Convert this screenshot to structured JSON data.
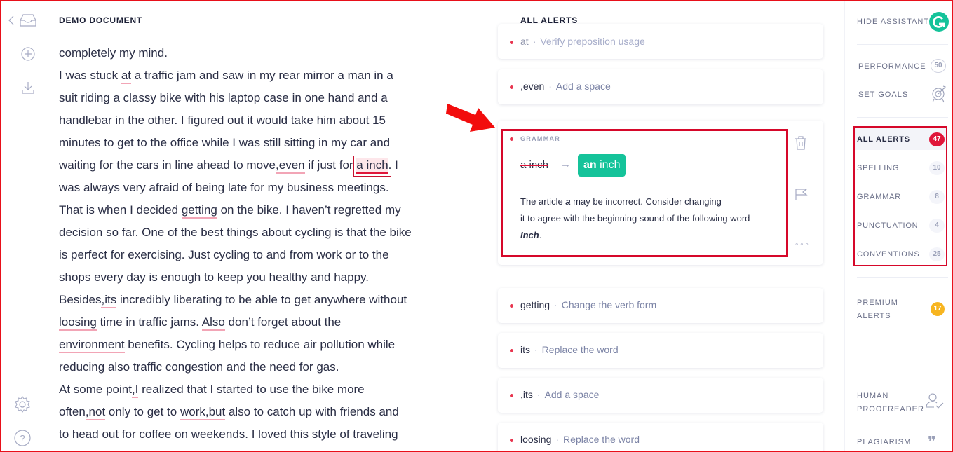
{
  "document": {
    "title": "DEMO DOCUMENT",
    "lines": [
      [
        {
          "t": "completely my mind."
        }
      ],
      [
        {
          "t": "I was stuck "
        },
        {
          "t": "at",
          "u": true
        },
        {
          "t": " a traffic jam and saw in my rear mirror a man in a"
        }
      ],
      [
        {
          "t": "suit riding a classy bike with his laptop case in one hand and a"
        }
      ],
      [
        {
          "t": "handlebar in the other. I figured out it would take him about 15"
        }
      ],
      [
        {
          "t": "minutes to get to the office while I was still sitting in my car and"
        }
      ],
      [
        {
          "t": "waiting for the cars in line ahead to move"
        },
        {
          "t": ",even",
          "u": true
        },
        {
          "t": " if just for "
        },
        {
          "t": "a inch",
          "active": true
        },
        {
          "t": ". I"
        }
      ],
      [
        {
          "t": "was always very afraid of being late for my business meetings."
        }
      ],
      [
        {
          "t": "That is when I decided "
        },
        {
          "t": "getting",
          "u": true
        },
        {
          "t": " on the bike. I haven’t regretted my"
        }
      ],
      [
        {
          "t": "decision so far. One of the best things about cycling is that the bike"
        }
      ],
      [
        {
          "t": "is perfect for exercising. Just cycling to and from work or to the"
        }
      ],
      [
        {
          "t": "shops every day is enough to keep you healthy and happy."
        }
      ],
      [
        {
          "t": "Besides"
        },
        {
          "t": ",its",
          "u": true
        },
        {
          "t": " incredibly liberating to be able to get anywhere without"
        }
      ],
      [
        {
          "t": "loosing",
          "u": true
        },
        {
          "t": " time in traffic jams. "
        },
        {
          "t": "Also",
          "u": true
        },
        {
          "t": " don’t forget about the"
        }
      ],
      [
        {
          "t": "environment",
          "u": true
        },
        {
          "t": " benefits. Cycling helps to reduce air pollution while"
        }
      ],
      [
        {
          "t": "reducing also traffic congestion and the need for gas."
        }
      ],
      [
        {
          "t": "At some point"
        },
        {
          "t": ",I",
          "u": true
        },
        {
          "t": " realized that I started to use the bike more"
        }
      ],
      [
        {
          "t": "often"
        },
        {
          "t": ",not",
          "u": true
        },
        {
          "t": " only to get to "
        },
        {
          "t": "work,but",
          "u": true
        },
        {
          "t": " also to catch up with friends and"
        }
      ],
      [
        {
          "t": "to head out for coffee on weekends. I loved this style of traveling"
        }
      ]
    ]
  },
  "alerts": {
    "title": "ALL ALERTS",
    "items": [
      {
        "word": "at",
        "sep": "·",
        "desc": "Verify preposition usage"
      },
      {
        "word": ",even",
        "sep": "·",
        "desc": "Add a space"
      },
      {
        "word": "getting",
        "sep": "·",
        "desc": "Change the verb form"
      },
      {
        "word": "its",
        "sep": "·",
        "desc": "Replace the word"
      },
      {
        "word": ",its",
        "sep": "·",
        "desc": "Add a space"
      },
      {
        "word": "loosing",
        "sep": "·",
        "desc": "Replace the word"
      }
    ],
    "expanded": {
      "category": "GRAMMAR",
      "original": "a inch",
      "arrow": "→",
      "fix_bold": "an",
      "fix_rest": " inch",
      "text_1": "The article ",
      "text_em": "a",
      "text_2": " may be incorrect. Consider changing",
      "text_3": "it to agree with the beginning sound of the following word",
      "text_em2": "Inch",
      "text_4": ".",
      "more": "∘∘∘"
    }
  },
  "sidebar": {
    "hide_assistant": "HIDE ASSISTANT",
    "performance": "PERFORMANCE",
    "performance_score": "50",
    "set_goals": "SET GOALS",
    "categories": [
      {
        "label": "ALL ALERTS",
        "count": "47",
        "active": true
      },
      {
        "label": "SPELLING",
        "count": "10"
      },
      {
        "label": "GRAMMAR",
        "count": "8"
      },
      {
        "label": "PUNCTUATION",
        "count": "4"
      },
      {
        "label": "CONVENTIONS",
        "count": "25"
      }
    ],
    "premium_1": "PREMIUM",
    "premium_2": "ALERTS",
    "premium_count": "17",
    "human_1": "HUMAN",
    "human_2": "PROOFREADER",
    "plagiarism": "PLAGIARISM",
    "plagiarism_icon": "❞"
  },
  "colors": {
    "accent_green": "#15c39a",
    "alert_red": "#e0163a",
    "premium_yellow": "#f7b520",
    "annotation_red": "#d6082a"
  }
}
